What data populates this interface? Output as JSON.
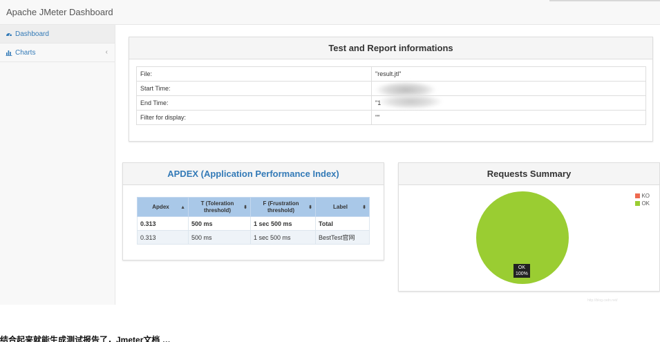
{
  "app": {
    "title": "Apache JMeter Dashboard"
  },
  "sidebar": {
    "items": [
      {
        "label": "Dashboard",
        "icon": "dashboard-icon"
      },
      {
        "label": "Charts",
        "icon": "bar-chart-icon",
        "chevron": "‹"
      }
    ]
  },
  "info_panel": {
    "title": "Test and Report informations",
    "rows": [
      {
        "key": "File:",
        "value": "\"result.jtl\""
      },
      {
        "key": "Start Time:",
        "value": ""
      },
      {
        "key": "End Time:",
        "value": "\"1"
      },
      {
        "key": "Filter for display:",
        "value": "\"\""
      }
    ]
  },
  "apdex_panel": {
    "title": "APDEX (Application Performance Index)",
    "headers": [
      "Apdex",
      "T (Toleration threshold)",
      "F (Frustration threshold)",
      "Label"
    ],
    "rows": [
      [
        "0.313",
        "500 ms",
        "1 sec 500 ms",
        "Total"
      ],
      [
        "0.313",
        "500 ms",
        "1 sec 500 ms",
        "BestTest官网"
      ]
    ]
  },
  "summary_panel": {
    "title": "Requests Summary",
    "legend": [
      {
        "label": "KO",
        "color": "#ee6a50"
      },
      {
        "label": "OK",
        "color": "#9acd32"
      }
    ]
  },
  "chart_data": {
    "type": "pie",
    "title": "Requests Summary",
    "slices": [
      {
        "label": "OK",
        "value": 100,
        "display": "100%",
        "color": "#9acd32"
      },
      {
        "label": "KO",
        "value": 0,
        "display": "0%",
        "color": "#ee6a50"
      }
    ]
  },
  "footer": {
    "text": "结合起来就能生成测试报告了，Jmeter文档 …"
  },
  "colors": {
    "accent": "#337ab7",
    "ok": "#9acd32",
    "ko": "#ee6a50"
  }
}
